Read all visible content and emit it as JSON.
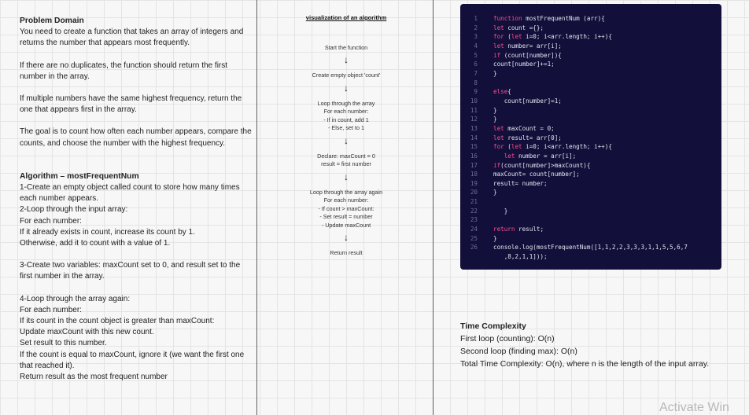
{
  "problem": {
    "heading": "Problem Domain",
    "p1": "You need to create a function that takes an array of integers and returns the number that appears most frequently.",
    "p2": "If there are no duplicates, the function should return the first number in the array.",
    "p3": "If multiple numbers have the same highest frequency, return the one that appears first in the array.",
    "p4": "The goal is to count how often each number appears, compare the counts, and choose the number with the highest frequency."
  },
  "algorithm": {
    "heading": "Algorithm – mostFrequentNum",
    "lines": [
      "1-Create an empty object called count to store how many times each number appears.",
      "2-Loop through the input array:",
      "For each number:",
      "If it already exists in count, increase its count by 1.",
      "Otherwise, add it to count with a value of 1."
    ],
    "step3": "3-Create two variables: maxCount set to 0, and result set to the first number in the array.",
    "step4": [
      "4-Loop through the array again:",
      "For each number:",
      "If its count in the count object is greater than maxCount:",
      "Update maxCount with this new count.",
      "Set result to this number.",
      "If the count is equal to maxCount, ignore it (we want the first one that reached it).",
      "Return result as the most frequent number"
    ]
  },
  "flow": {
    "title": "visualization of an algorithm",
    "steps": [
      [
        "Start the function"
      ],
      [
        "Create empty object 'count'"
      ],
      [
        "Loop through the array",
        "For each number:",
        "- If in count, add 1",
        "- Else, set to 1"
      ],
      [
        "Declare:  maxCount = 0",
        "result = first number"
      ],
      [
        "Loop through the array again",
        "For each number:",
        "- If count > maxCount:",
        "- Set result = number",
        "- Update maxCount"
      ],
      [
        "Return result"
      ]
    ]
  },
  "code": {
    "line_numbers": [
      "1",
      "2",
      "3",
      "4",
      "5",
      "6",
      "7",
      "8",
      "9",
      "10",
      "11",
      "12",
      "13",
      "14",
      "15",
      "16",
      "17",
      "18",
      "19",
      "20",
      "21",
      "22",
      "23",
      "24",
      "25",
      "26"
    ],
    "lines": [
      "function mostFrequentNum (arr){",
      "let count ={};",
      "for (let i=0; i<arr.length; i++){",
      "let number= arr[i];",
      "if (count[number]){",
      "count[number]+=1;",
      "}",
      "",
      "else{",
      "   count[number]=1;",
      "}",
      "}",
      "let maxCount = 0;",
      "let result= arr[0];",
      "for (let i=0; i<arr.length; i++){",
      "   let number = arr[i];",
      "if(count[number]>maxCount){",
      "maxCount= count[number];",
      "result= number;",
      "}",
      "",
      "   }",
      "",
      "return result;",
      "}",
      "console.log(mostFrequentNum([1,1,2,2,3,3,3,1,1,5,5,6,7",
      "   ,8,2,1,1]));"
    ]
  },
  "complexity": {
    "heading": "Time Complexity",
    "lines": [
      "First loop (counting): O(n)",
      "Second loop (finding max): O(n)",
      "Total Time Complexity: O(n), where n is the length of the input array."
    ]
  },
  "watermark": "Activate Win",
  "colors": {
    "code_bg": "#120f3a",
    "keyword": "#ff4d8d",
    "line_number": "#6f6c98"
  }
}
